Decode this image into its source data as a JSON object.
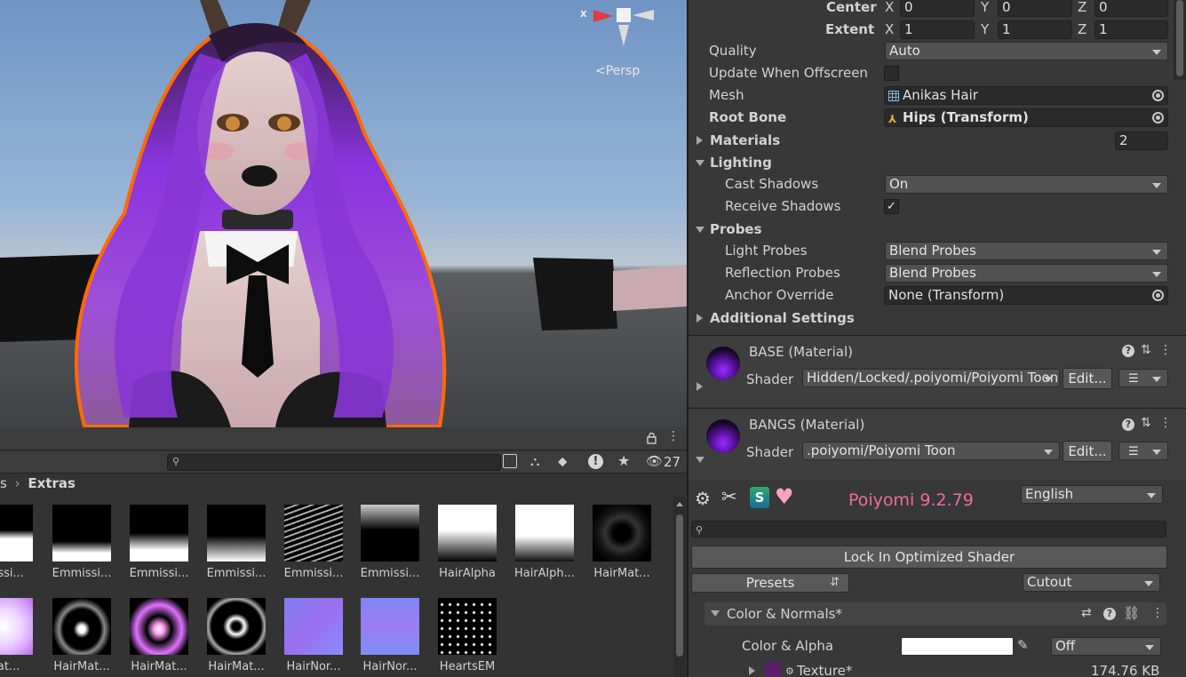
{
  "scene": {
    "gizmo_axis": "x",
    "projection_label": "<Persp"
  },
  "project": {
    "hidden_count": "27",
    "breadcrumb_prev": "s",
    "breadcrumb_current": "Extras",
    "assets_row1": [
      "missi...",
      "Emmissi...",
      "Emmissi...",
      "Emmissi...",
      "Emmissi...",
      "Emmissi...",
      "HairAlpha",
      "HairAlph...",
      "HairMat..."
    ],
    "assets_row2": [
      "Mat...",
      "HairMat...",
      "HairMat...",
      "HairMat...",
      "HairNor...",
      "HairNor...",
      "HeartsEM"
    ]
  },
  "inspector": {
    "bounds": {
      "center_label": "Center",
      "extent_label": "Extent",
      "center": {
        "x": "0",
        "y": "0",
        "z": "0"
      },
      "extent": {
        "x": "1",
        "y": "1",
        "z": "1"
      },
      "axis_x": "X",
      "axis_y": "Y",
      "axis_z": "Z"
    },
    "quality_label": "Quality",
    "quality_value": "Auto",
    "update_offscreen_label": "Update When Offscreen",
    "mesh_label": "Mesh",
    "mesh_value": "Anikas Hair",
    "root_bone_label": "Root Bone",
    "root_bone_value": "Hips (Transform)",
    "materials_label": "Materials",
    "materials_count": "2",
    "lighting_label": "Lighting",
    "cast_shadows_label": "Cast Shadows",
    "cast_shadows_value": "On",
    "receive_shadows_label": "Receive Shadows",
    "receive_shadows_check": "✓",
    "probes_label": "Probes",
    "light_probes_label": "Light Probes",
    "light_probes_value": "Blend Probes",
    "reflection_probes_label": "Reflection Probes",
    "reflection_probes_value": "Blend Probes",
    "anchor_override_label": "Anchor Override",
    "anchor_override_value": "None (Transform)",
    "additional_settings_label": "Additional Settings",
    "materials_list": [
      {
        "name": "BASE (Material)",
        "shader_label": "Shader",
        "shader": "Hidden/Locked/.poiyomi/Poiyomi Toon",
        "edit": "Edit..."
      },
      {
        "name": "BANGS (Material)",
        "shader_label": "Shader",
        "shader": ".poiyomi/Poiyomi Toon",
        "edit": "Edit..."
      }
    ],
    "poiyomi": {
      "version": "Poiyomi 9.2.79",
      "language": "English",
      "lock_button": "Lock In Optimized Shader",
      "presets_button": "Presets",
      "render_mode": "Cutout",
      "section_label": "Color & Normals*",
      "color_alpha_label": "Color & Alpha",
      "color_mode": "Off",
      "texture_label": "Texture*",
      "texture_size": "174.76 KB"
    }
  },
  "colors": {
    "accent_pink": "#f06aa0",
    "selection_orange": "#ff6a00",
    "hair_purple": "#7a2fd0"
  }
}
